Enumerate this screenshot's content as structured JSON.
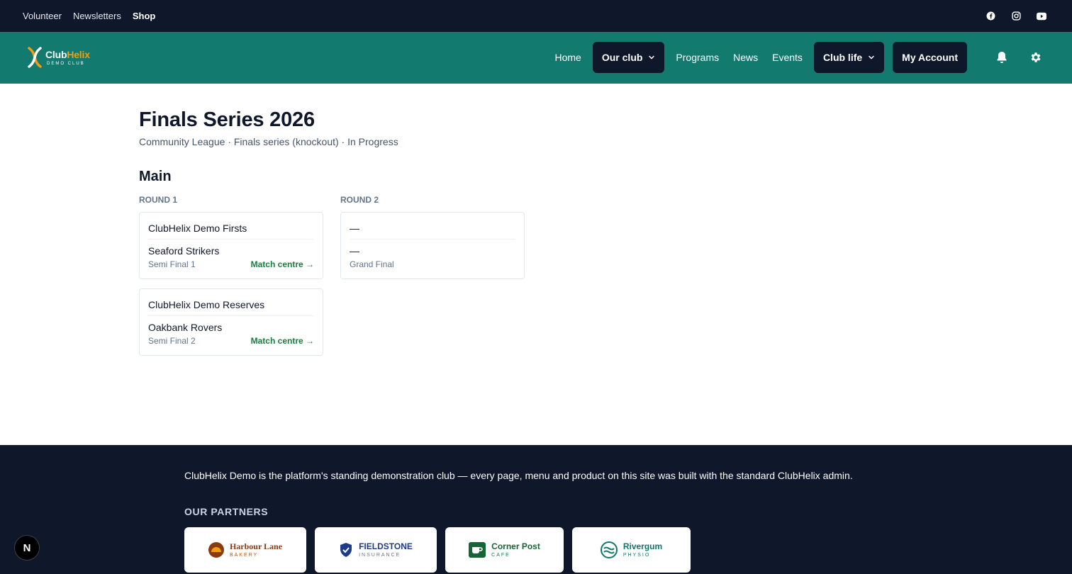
{
  "topbar": {
    "links": [
      {
        "label": "Volunteer"
      },
      {
        "label": "Newsletters"
      },
      {
        "label": "Shop"
      }
    ],
    "social_icons": [
      "facebook-icon",
      "instagram-icon",
      "youtube-icon"
    ]
  },
  "nav": {
    "logo": {
      "name_part1": "Club",
      "name_part2": "Helix",
      "sub": "DEMO CLUB"
    },
    "items": {
      "home": "Home",
      "our_club": "Our club",
      "programs": "Programs",
      "news": "News",
      "events": "Events",
      "club_life": "Club life",
      "my_account": "My Account"
    },
    "icons": [
      "bell-icon",
      "gear-icon"
    ]
  },
  "page": {
    "title": "Finals Series 2026",
    "meta": "Community League · Finals series (knockout) · In Progress",
    "section": "Main"
  },
  "bracket": {
    "rounds": [
      {
        "label": "ROUND 1",
        "matches": [
          {
            "team1": "ClubHelix Demo Firsts",
            "team2": "Seaford Strikers",
            "stage": "Semi Final 1",
            "link": "Match centre →"
          },
          {
            "team1": "ClubHelix Demo Reserves",
            "team2": "Oakbank Rovers",
            "stage": "Semi Final 2",
            "link": "Match centre →"
          }
        ]
      },
      {
        "label": "ROUND 2",
        "matches": [
          {
            "team1": "—",
            "team2": "—",
            "stage": "Grand Final"
          }
        ]
      }
    ]
  },
  "footer": {
    "text": "ClubHelix Demo is the platform's standing demonstration club — every page, menu and product on this site was built with the standard ClubHelix admin.",
    "partners_title": "OUR PARTNERS",
    "partners": [
      {
        "name": "Harbour Lane",
        "sub": "BAKERY",
        "color": "#8a3b12",
        "icon": "sun-icon"
      },
      {
        "name": "FIELDSTONE",
        "sub": "INSURANCE",
        "color": "#1e3a8a",
        "icon": "shield-icon"
      },
      {
        "name": "Corner Post",
        "sub": "CAFE",
        "color": "#166534",
        "icon": "cup-icon"
      },
      {
        "name": "Rivergum",
        "sub": "PHYSIO",
        "color": "#0f766e",
        "icon": "wave-icon"
      }
    ]
  },
  "badge": "N",
  "colors": {
    "nav_bg": "#127a6f",
    "dark": "#0f172a",
    "accent": "#f59e0b",
    "link_green": "#15803d"
  }
}
